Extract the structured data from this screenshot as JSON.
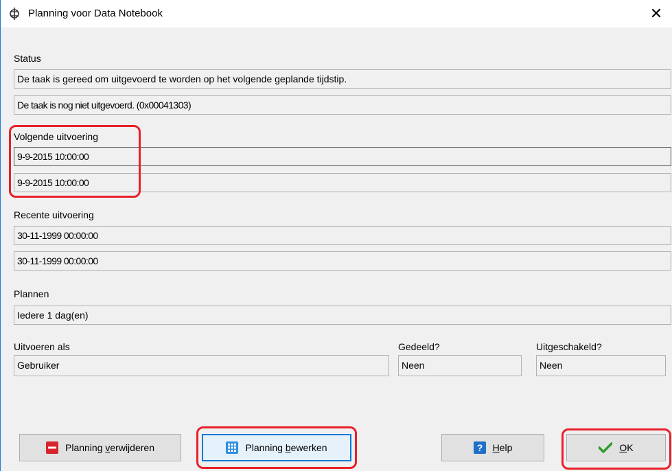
{
  "window": {
    "title": "Planning voor Data Notebook",
    "close_glyph": "✕"
  },
  "status": {
    "label": "Status",
    "line1": "De taak is gereed om uitgevoerd te worden op het volgende geplande tijdstip.",
    "line2": "De taak is nog niet uitgevoerd. (0x00041303)"
  },
  "next_run": {
    "label": "Volgende uitvoering",
    "value1": "9-9-2015 10:00:00",
    "value2": "9-9-2015 10:00:00"
  },
  "recent_run": {
    "label": "Recente uitvoering",
    "value1": "30-11-1999 00:00:00",
    "value2": "30-11-1999 00:00:00"
  },
  "schedule": {
    "label": "Plannen",
    "value": "Iedere 1 dag(en)"
  },
  "run_as": {
    "label": "Uitvoeren als",
    "value": "Gebruiker"
  },
  "shared": {
    "label": "Gedeeld?",
    "value": "Neen"
  },
  "disabled": {
    "label": "Uitgeschakeld?",
    "value": "Neen"
  },
  "buttons": {
    "delete": {
      "pre": "Planning ",
      "key": "v",
      "post": "erwijderen",
      "icon": "minus-icon"
    },
    "edit": {
      "pre": "Planning ",
      "key": "b",
      "post": "ewerken",
      "icon": "grid-icon"
    },
    "help": {
      "pre": "",
      "key": "H",
      "post": "elp",
      "icon": "question-icon"
    },
    "ok": {
      "pre": "",
      "key": "O",
      "post": "K",
      "icon": "checkmark-icon"
    }
  },
  "colors": {
    "accent": "#0078d7",
    "highlight": "#e8202a",
    "ok_green": "#2e9d2e",
    "delete_red": "#d9232d"
  }
}
